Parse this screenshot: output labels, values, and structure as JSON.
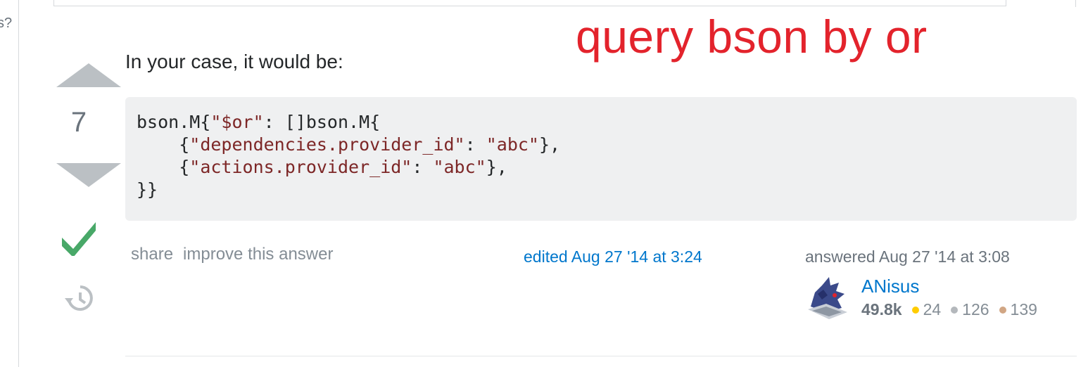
{
  "page": {
    "left_cut_text": "s?",
    "annotation": "query bson by or"
  },
  "vote": {
    "count": "7"
  },
  "answer": {
    "intro": "In your case, it would be:",
    "code_lines": [
      "bson.M{\"$or\": []bson.M{",
      "    {\"dependencies.provider_id\": \"abc\"},",
      "    {\"actions.provider_id\": \"abc\"},",
      "}}"
    ]
  },
  "menu": {
    "share_label": "share",
    "improve_label": "improve this answer"
  },
  "edited_text": "edited Aug 27 '14 at 3:24",
  "answered_text": "answered Aug 27 '14 at 3:08",
  "user": {
    "name": "ANisus",
    "reputation": "49.8k",
    "gold_badges": "24",
    "silver_badges": "126",
    "bronze_badges": "139"
  },
  "colors": {
    "accent_link": "#0077cc",
    "accepted_check": "#48a868",
    "annotation_red": "#e3232c",
    "code_string": "#7d2727"
  }
}
